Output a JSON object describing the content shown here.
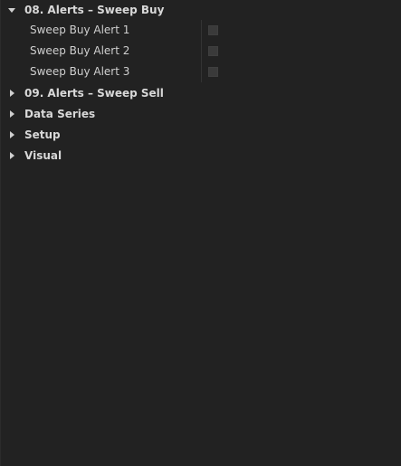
{
  "groups": {
    "alerts_buy": {
      "label": "08. Alerts – Sweep Buy",
      "expanded": true,
      "items": [
        {
          "label": "Sweep Buy Alert 1",
          "checked": false
        },
        {
          "label": "Sweep Buy Alert 2",
          "checked": false
        },
        {
          "label": "Sweep Buy Alert 3",
          "checked": false
        }
      ]
    },
    "alerts_sell": {
      "label": "09. Alerts – Sweep Sell",
      "expanded": false
    },
    "data_series": {
      "label": "Data Series",
      "expanded": false
    },
    "setup": {
      "label": "Setup",
      "expanded": false
    },
    "visual": {
      "label": "Visual",
      "expanded": false
    }
  },
  "colors": {
    "background": "#222222",
    "text": "#d2d2d2",
    "checkbox": "#3a3a3a"
  }
}
